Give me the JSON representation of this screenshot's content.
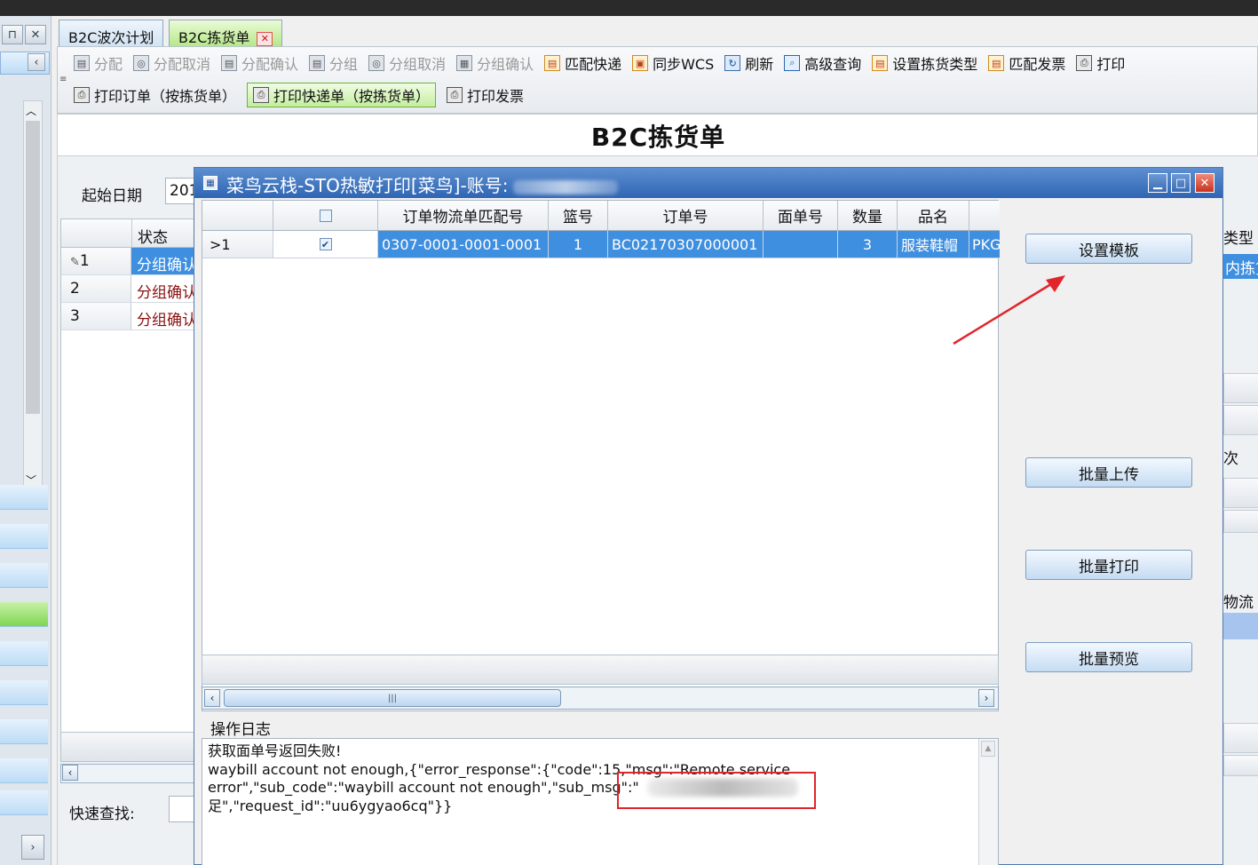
{
  "tabs": [
    {
      "label": "B2C波次计划",
      "active": false
    },
    {
      "label": "B2C拣货单",
      "active": true,
      "close": "✕"
    }
  ],
  "toolbar": {
    "row1": [
      {
        "label": "分配",
        "enabled": false,
        "icon": "doc-icon"
      },
      {
        "label": "分配取消",
        "enabled": false,
        "icon": "cancel-icon"
      },
      {
        "label": "分配确认",
        "enabled": false,
        "icon": "doc-icon"
      },
      {
        "label": "分组",
        "enabled": false,
        "icon": "doc-icon"
      },
      {
        "label": "分组取消",
        "enabled": false,
        "icon": "cancel-icon"
      },
      {
        "label": "分组确认",
        "enabled": false,
        "icon": "grid-icon"
      },
      {
        "label": "匹配快递",
        "enabled": true,
        "icon": "doc-icon"
      },
      {
        "label": "同步WCS",
        "enabled": true,
        "icon": "clipboard-icon"
      },
      {
        "label": "刷新",
        "enabled": true,
        "icon": "refresh-icon"
      },
      {
        "label": "高级查询",
        "enabled": true,
        "icon": "query-icon"
      },
      {
        "label": "设置拣货类型",
        "enabled": true,
        "icon": "doc-icon"
      },
      {
        "label": "匹配发票",
        "enabled": true,
        "icon": "doc-icon"
      },
      {
        "label": "打印",
        "enabled": true,
        "icon": "printer-icon"
      }
    ],
    "row2": [
      {
        "label": "打印订单（按拣货单）",
        "icon": "printer-icon",
        "highlight": false
      },
      {
        "label": "打印快递单（按拣货单）",
        "icon": "printer-icon",
        "highlight": true
      },
      {
        "label": "打印发票",
        "icon": "printer-icon",
        "highlight": false
      }
    ]
  },
  "page": {
    "title": "B2C拣货单"
  },
  "background_form": {
    "start_date_label": "起始日期",
    "start_date_value": "201",
    "grid_header_status": "状态",
    "rows": [
      {
        "num": "1",
        "status": "分组确认",
        "selected": true,
        "edit_icon": "✎"
      },
      {
        "num": "2",
        "status": "分组确认",
        "selected": false
      },
      {
        "num": "3",
        "status": "分组确认",
        "selected": false
      }
    ],
    "quick_search_label": "快速查找:",
    "right_labels": {
      "type": "类型",
      "inner": "内拣货",
      "batch": "次",
      "logistics": "物流"
    }
  },
  "dialog": {
    "title": "菜鸟云栈-STO热敏打印[菜鸟]-账号:",
    "columns": [
      "",
      "",
      "订单物流单匹配号",
      "篮号",
      "订单号",
      "面单号",
      "数量",
      "品名",
      ""
    ],
    "rows": [
      {
        "indicator": ">1",
        "checked": true,
        "match_no": "0307-0001-0001-0001",
        "basket": "1",
        "order_no": "BC02170307000001",
        "waybill_no": "",
        "qty": "3",
        "product": "服装鞋帽",
        "extra": "PKG"
      }
    ],
    "buttons": {
      "set_template": "设置模板",
      "batch_upload": "批量上传",
      "batch_print": "批量打印",
      "batch_preview": "批量预览"
    },
    "log_label": "操作日志",
    "log_text": "获取面单号返回失败!\nwaybill account not enough,{\"error_response\":{\"code\":15,\"msg\":\"Remote service error\",\"sub_code\":\"waybill account not enough\",\"sub_msg\":\"                        \n足\",\"request_id\":\"uu6ygyao6cq\"}}"
  },
  "colors": {
    "accent": "#3f8fe0",
    "title_bar": "#2f65b4",
    "annotation_red": "#e0252b",
    "status_text": "#8b1010"
  }
}
